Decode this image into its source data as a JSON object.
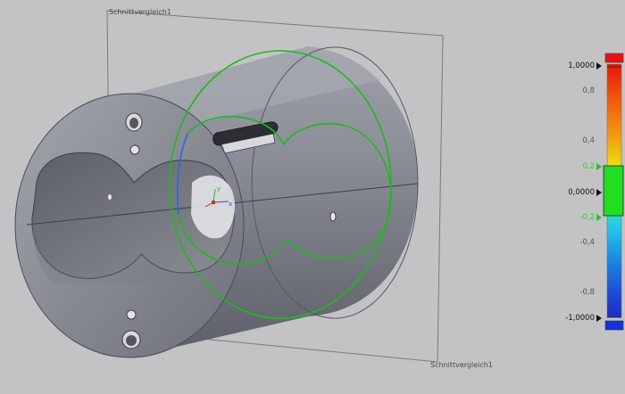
{
  "viewport": {
    "section_plane_label": "Schnittvergleich1"
  },
  "legend": {
    "ticks": [
      {
        "label": "1,0000",
        "style": "bold",
        "marker": "black"
      },
      {
        "label": "0,8",
        "style": "grey",
        "marker": ""
      },
      {
        "label": "0,4",
        "style": "grey",
        "marker": ""
      },
      {
        "label": "0,2",
        "style": "green",
        "marker": "green"
      },
      {
        "label": "0,0000",
        "style": "bold",
        "marker": "black"
      },
      {
        "label": "-0,2",
        "style": "green",
        "marker": "green"
      },
      {
        "label": "-0,4",
        "style": "grey",
        "marker": ""
      },
      {
        "label": "-0,8",
        "style": "grey",
        "marker": ""
      },
      {
        "label": "-1,0000",
        "style": "bold",
        "marker": "black"
      }
    ],
    "colors": {
      "top_cap": "#ee1111",
      "bottom_cap": "#1133dd",
      "tolerance_band": "#22dd22"
    }
  },
  "model": {
    "icons": [
      "coordinate-triad-icon"
    ],
    "colors": {
      "body": "#8e9099",
      "contour": "#1fb81f",
      "highlight": "#1e6fd8"
    }
  }
}
